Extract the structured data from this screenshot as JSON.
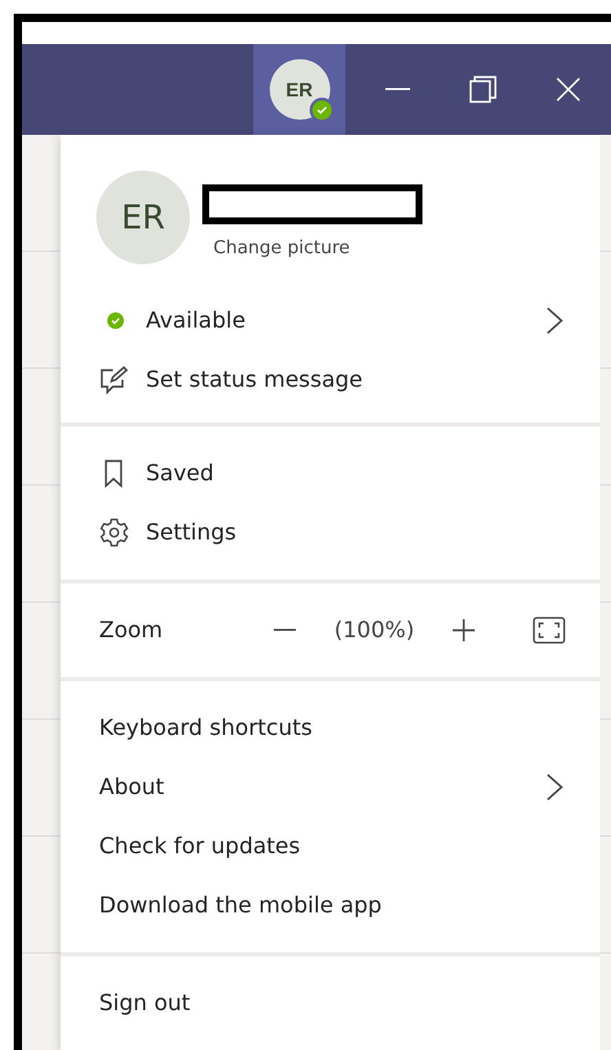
{
  "title_bar": {
    "avatar": {
      "initials": "ER"
    }
  },
  "profile": {
    "initials": "ER",
    "change_picture": "Change picture"
  },
  "sections": [
    {
      "items": [
        {
          "kind": "status",
          "label": "Available",
          "has_submenu": true
        },
        {
          "kind": "compose",
          "label": "Set status message",
          "has_submenu": false
        }
      ]
    },
    {
      "items": [
        {
          "kind": "bookmark",
          "label": "Saved",
          "has_submenu": false
        },
        {
          "kind": "gear",
          "label": "Settings",
          "has_submenu": false
        }
      ]
    },
    {
      "items": [
        {
          "kind": "zoom",
          "label": "Zoom",
          "value": "(100%)"
        }
      ]
    },
    {
      "items": [
        {
          "kind": "plain",
          "label": "Keyboard shortcuts",
          "has_submenu": false
        },
        {
          "kind": "plain",
          "label": "About",
          "has_submenu": true
        },
        {
          "kind": "plain",
          "label": "Check for updates",
          "has_submenu": false
        },
        {
          "kind": "plain",
          "label": "Download the mobile app",
          "has_submenu": false
        }
      ]
    },
    {
      "items": [
        {
          "kind": "plain",
          "label": "Sign out",
          "has_submenu": false
        }
      ]
    }
  ]
}
